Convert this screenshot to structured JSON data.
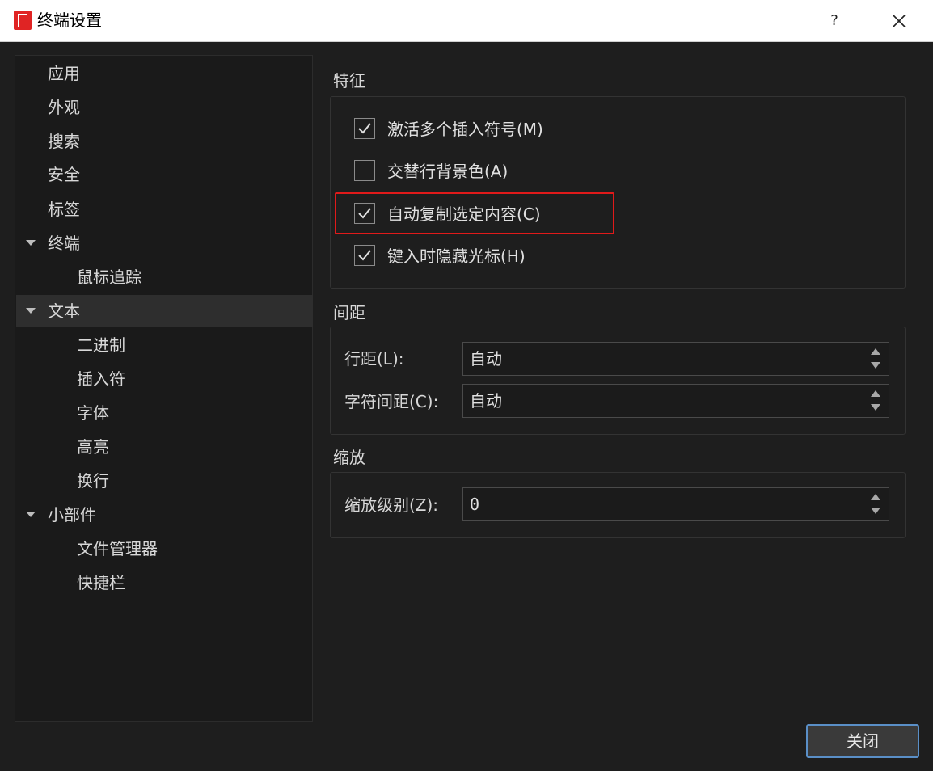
{
  "window": {
    "title": "终端设置",
    "help_label": "?",
    "app_icon": "app-logo-icon",
    "close_icon": "close-icon"
  },
  "sidebar": {
    "items": [
      {
        "label": "应用"
      },
      {
        "label": "外观"
      },
      {
        "label": "搜索"
      },
      {
        "label": "安全"
      },
      {
        "label": "标签"
      },
      {
        "label": "终端"
      },
      {
        "label": "鼠标追踪"
      },
      {
        "label": "文本"
      },
      {
        "label": "二进制"
      },
      {
        "label": "插入符"
      },
      {
        "label": "字体"
      },
      {
        "label": "高亮"
      },
      {
        "label": "换行"
      },
      {
        "label": "小部件"
      },
      {
        "label": "文件管理器"
      },
      {
        "label": "快捷栏"
      }
    ],
    "selected": "文本"
  },
  "features": {
    "title": "特征",
    "checkboxes": [
      {
        "label": "激活多个插入符号(M)",
        "checked": true
      },
      {
        "label": "交替行背景色(A)",
        "checked": false
      },
      {
        "label": "自动复制选定内容(C)",
        "checked": true
      },
      {
        "label": "键入时隐藏光标(H)",
        "checked": true
      }
    ]
  },
  "spacing": {
    "title": "间距",
    "line_spacing_label": "行距(L):",
    "line_spacing_value": "自动",
    "char_spacing_label": "字符间距(C):",
    "char_spacing_value": "自动"
  },
  "zoom": {
    "title": "缩放",
    "zoom_level_label": "缩放级别(Z):",
    "zoom_level_value": "0"
  },
  "footer": {
    "close_label": "关闭"
  },
  "colors": {
    "background": "#1e1e1e",
    "highlight_border": "#e01a1a",
    "button_focus_border": "#5a8fc7",
    "app_icon_red": "#e02424"
  }
}
